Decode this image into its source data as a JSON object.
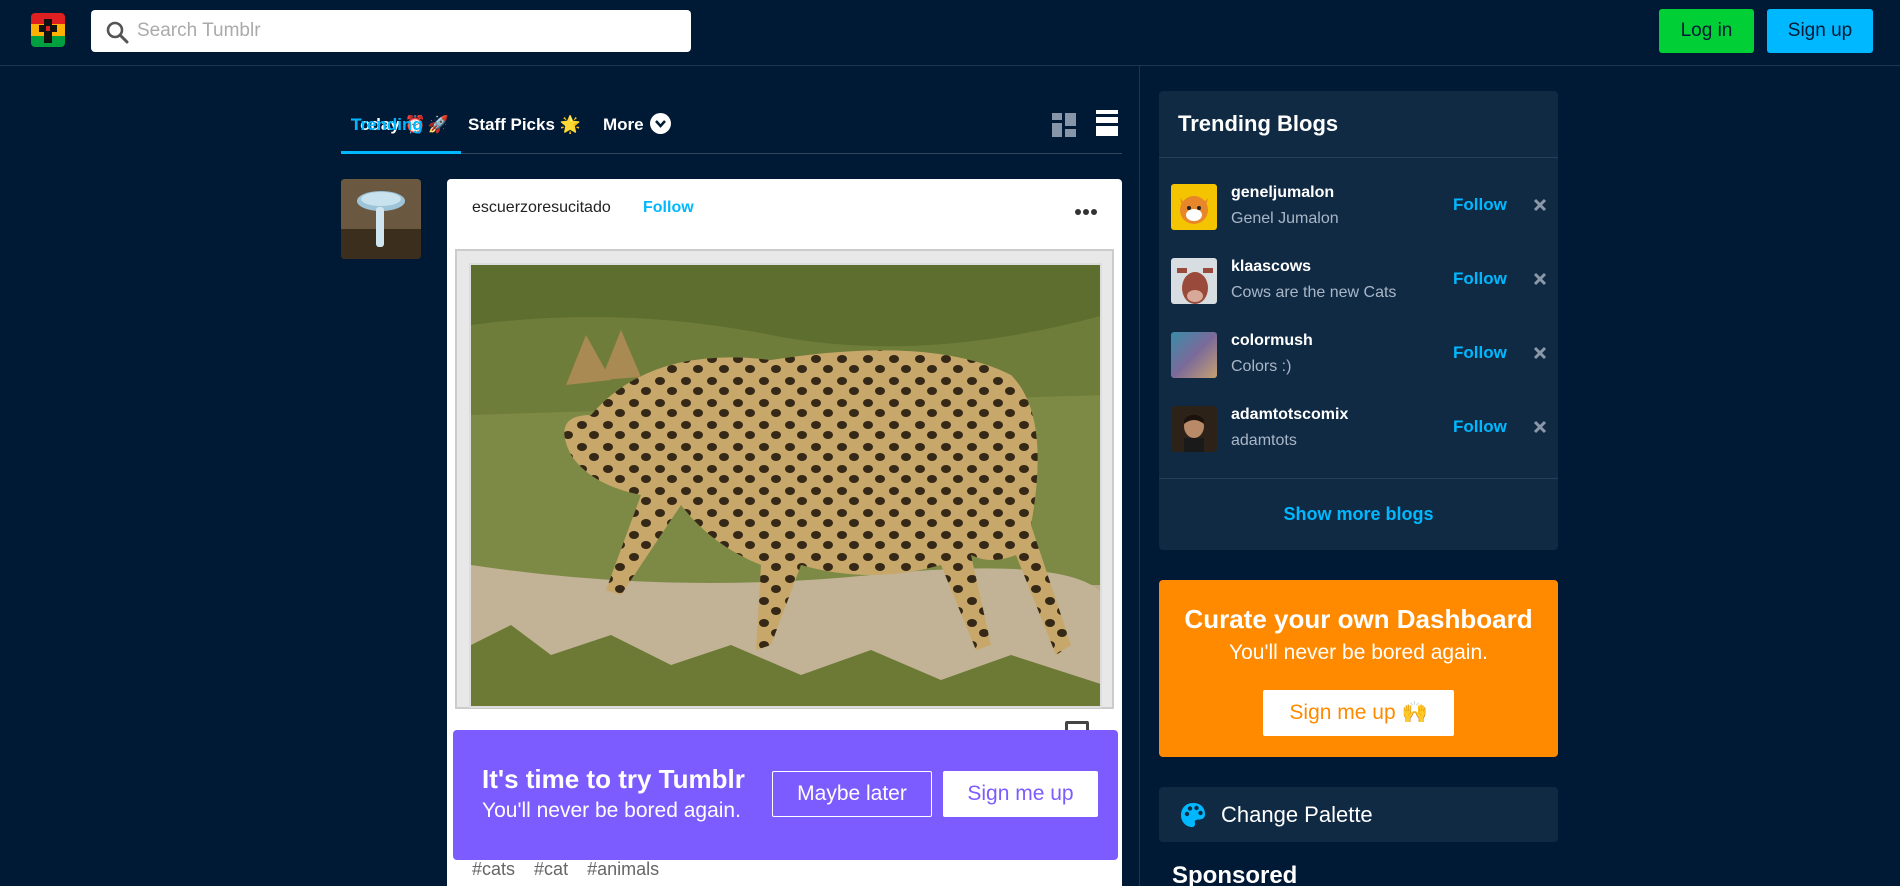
{
  "header": {
    "logo_icon": "tumblr-logo-icon",
    "search_placeholder": "Search Tumblr",
    "login_label": "Log in",
    "signup_label": "Sign up"
  },
  "tabs": [
    {
      "label": "Today ⏰",
      "active": false
    },
    {
      "label": "Trending 🚀",
      "active": true
    },
    {
      "label": "Staff Picks 🌟",
      "active": false
    },
    {
      "label": "More",
      "active": false
    }
  ],
  "post": {
    "username": "escuerzoresucitado",
    "follow_label": "Follow",
    "tags": [
      "#cats",
      "#cat",
      "#animals"
    ]
  },
  "try_banner": {
    "title": "It's time to try Tumblr",
    "subtitle": "You'll never be bored again.",
    "maybe_later": "Maybe later",
    "sign_me_up": "Sign me up"
  },
  "trending": {
    "title": "Trending Blogs",
    "blogs": [
      {
        "name": "geneljumalon",
        "desc": "Genel Jumalon",
        "follow": "Follow"
      },
      {
        "name": "klaascows",
        "desc": "Cows are the new Cats",
        "follow": "Follow"
      },
      {
        "name": "colormush",
        "desc": "Colors :)",
        "follow": "Follow"
      },
      {
        "name": "adamtotscomix",
        "desc": "adamtots",
        "follow": "Follow"
      }
    ],
    "show_more": "Show more blogs"
  },
  "curate": {
    "title": "Curate your own Dashboard",
    "subtitle": "You'll never be bored again.",
    "button": "Sign me up 🙌"
  },
  "palette": {
    "label": "Change Palette"
  },
  "sponsored": "Sponsored",
  "colors": {
    "background": "#001935",
    "accent_blue": "#00b8ff",
    "login_green": "#00cf35",
    "banner_purple": "#7c5cff",
    "curate_orange": "#ff8a00"
  }
}
